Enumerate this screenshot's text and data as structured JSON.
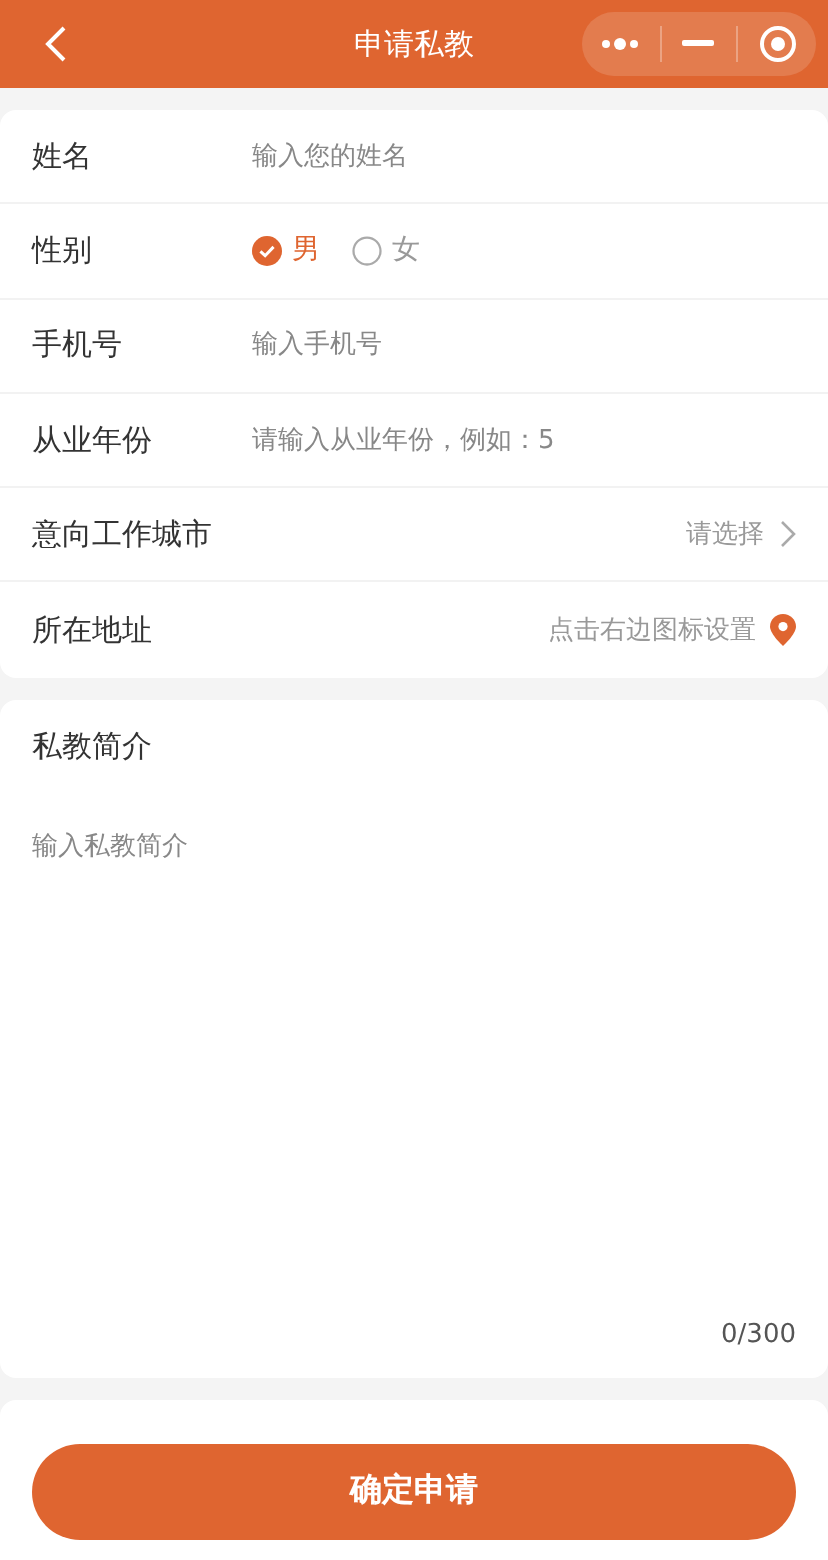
{
  "nav_bar": {
    "title": "申请私教"
  },
  "fields": [
    {
      "kind": "input",
      "label": "姓名",
      "placeholder": "输入您的姓名"
    },
    {
      "kind": "radio",
      "label": "性别",
      "options": [
        {
          "label": "男",
          "selected": true
        },
        {
          "label": "女",
          "selected": false
        }
      ]
    },
    {
      "kind": "input",
      "label": "手机号",
      "placeholder": "输入手机号"
    },
    {
      "kind": "input",
      "label": "从业年份",
      "placeholder": "请输入从业年份，例如：5"
    },
    {
      "kind": "picker",
      "label": "意向工作城市",
      "placeholder": "请选择"
    },
    {
      "kind": "location",
      "label": "所在地址",
      "placeholder": "点击右边图标设置"
    }
  ],
  "intro": {
    "label": "私教简介",
    "placeholder": "输入私教简介",
    "counter": "0/300"
  },
  "submit_button": "确定申请"
}
